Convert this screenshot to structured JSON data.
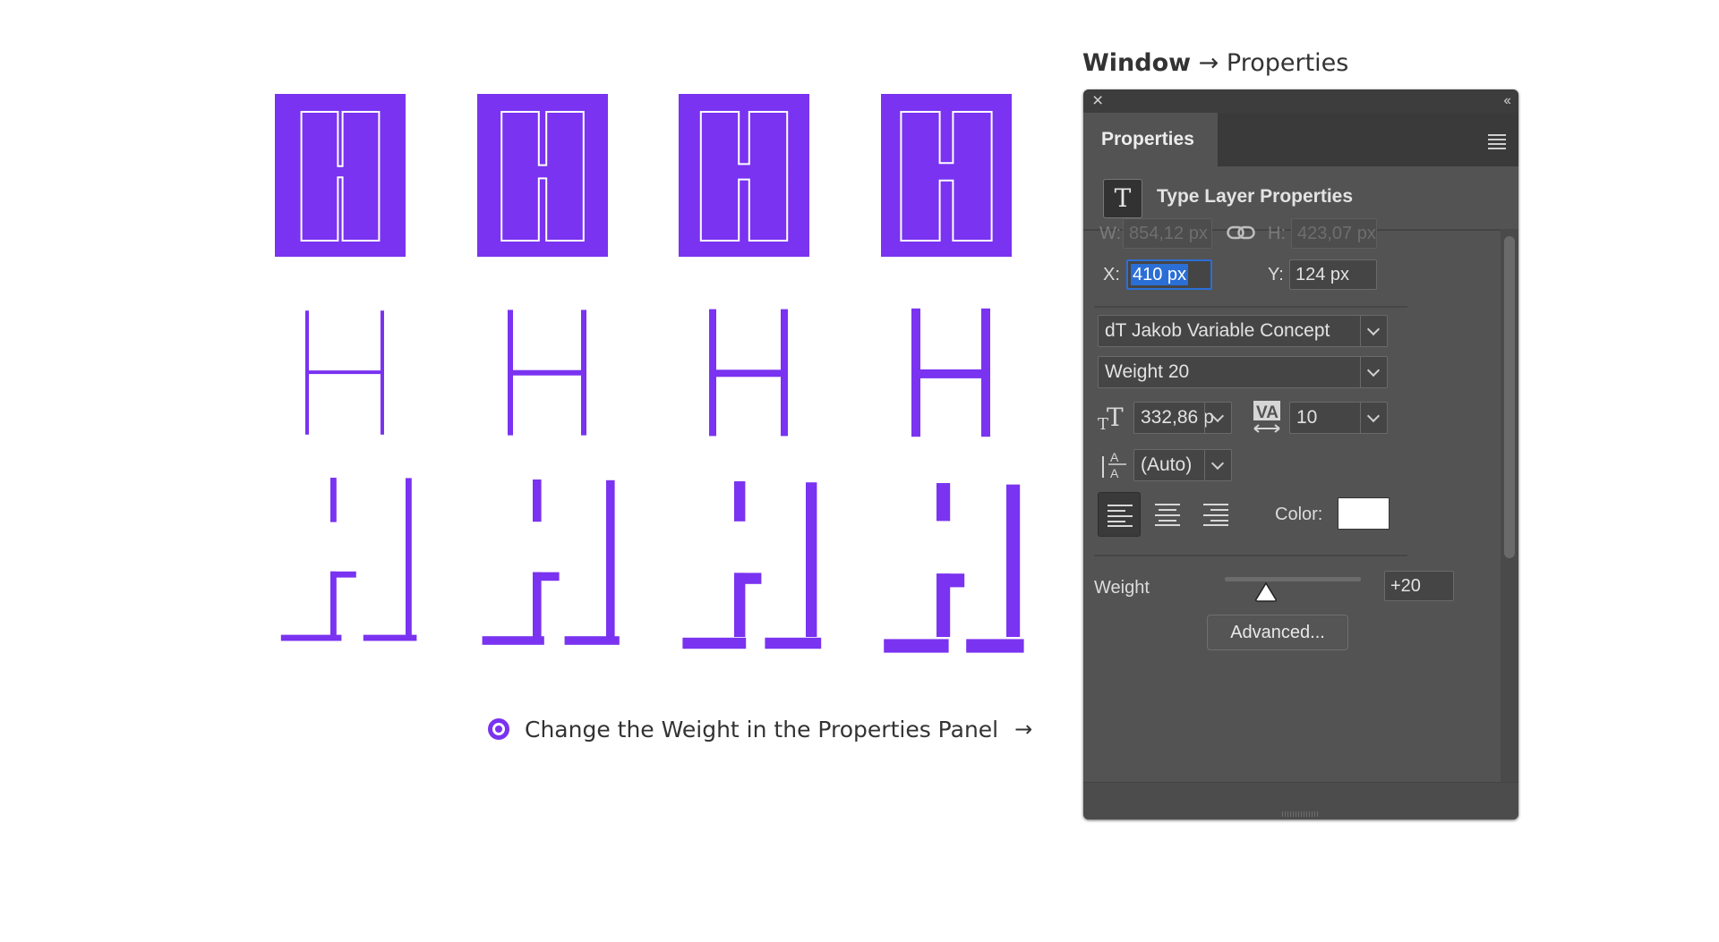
{
  "caption": {
    "bold": "Window",
    "arrow": "→",
    "rest": "Properties"
  },
  "hint": {
    "text": "Change the Weight in the Properties Panel",
    "arrow": "→"
  },
  "colors": {
    "accent": "#7a33f0",
    "panel": "#535353",
    "selection": "#2b6fd6"
  },
  "glyph_weights": [
    4,
    8,
    12,
    16
  ],
  "panel": {
    "close_icon": "close-icon",
    "collapse": "‹‹",
    "tab": "Properties",
    "layer_title": "Type Layer Properties",
    "layer_icon": "T",
    "transform": {
      "w_label": "W:",
      "w_value": "854,12 px",
      "h_label": "H:",
      "h_value": "423,07 px",
      "x_label": "X:",
      "x_value": "410 px",
      "y_label": "Y:",
      "y_value": "124 px"
    },
    "font_family": "dT Jakob Variable Concept",
    "font_style": "Weight 20",
    "font_size": "332,86 p",
    "tracking": "10",
    "leading": "(Auto)",
    "color_label": "Color:",
    "weight_label": "Weight",
    "weight_value": "+20",
    "weight_level": 0.3,
    "advanced": "Advanced..."
  }
}
